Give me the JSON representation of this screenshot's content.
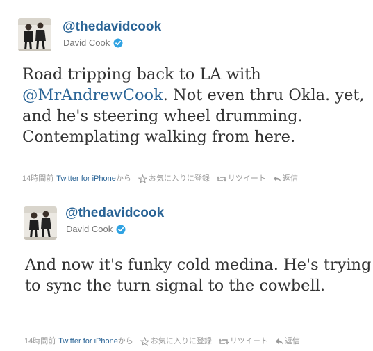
{
  "tweets": [
    {
      "handle": "@thedavidcook",
      "display_name": "David Cook",
      "text_before": "Road tripping back to LA with ",
      "mention": "@MrAndrewCook",
      "text_after": ". Not even thru Okla. yet, and he's steering wheel drumming. Contemplating walking from here.",
      "time": "14時間前",
      "source": "Twitter for iPhone",
      "source_suffix": "から",
      "favorite_label": "お気に入りに登録",
      "retweet_label": "リツイート",
      "reply_label": "返信"
    },
    {
      "handle": "@thedavidcook",
      "display_name": "David Cook",
      "text": "And now it's funky cold medina. He's trying to sync the turn signal to the cowbell.",
      "time": "14時間前",
      "source": "Twitter for iPhone",
      "source_suffix": "から",
      "favorite_label": "お気に入りに登録",
      "retweet_label": "リツイート",
      "reply_label": "返信"
    }
  ],
  "colors": {
    "link": "#2a6496",
    "text": "#333333",
    "meta": "#999999",
    "verified": "#2fa2e2"
  },
  "icons": [
    "verified-badge-icon",
    "star-icon",
    "retweet-icon",
    "reply-icon"
  ]
}
